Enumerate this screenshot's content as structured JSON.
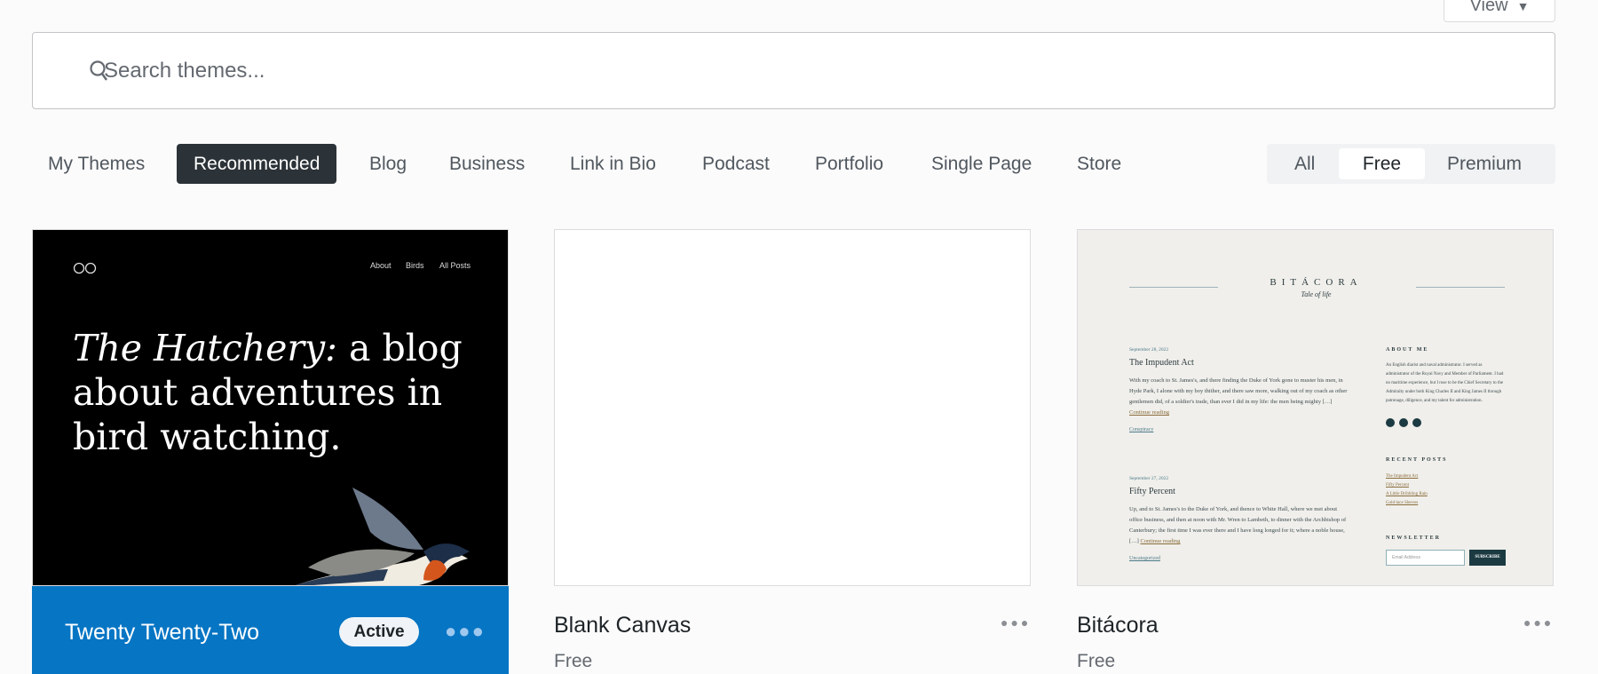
{
  "header": {
    "view_label": "View"
  },
  "search": {
    "placeholder": "Search themes..."
  },
  "tabs": [
    {
      "label": "My Themes"
    },
    {
      "label": "Recommended",
      "active": true
    },
    {
      "label": "Blog"
    },
    {
      "label": "Business"
    },
    {
      "label": "Link in Bio"
    },
    {
      "label": "Podcast"
    },
    {
      "label": "Portfolio"
    },
    {
      "label": "Single Page"
    },
    {
      "label": "Store"
    }
  ],
  "pricing": [
    {
      "label": "All"
    },
    {
      "label": "Free",
      "active": true
    },
    {
      "label": "Premium"
    }
  ],
  "colors": {
    "accent": "#0675c4",
    "active_tab": "#2c3338"
  },
  "themes": [
    {
      "name": "Twenty Twenty-Two",
      "badge": "Active",
      "preview": {
        "nav": [
          "About",
          "Birds",
          "All Posts"
        ],
        "headline_italic": "The Hatchery:",
        "headline_rest": " a blog about adventures in bird watching."
      }
    },
    {
      "name": "Blank Canvas",
      "price": "Free"
    },
    {
      "name": "Bitácora",
      "price": "Free",
      "preview": {
        "site_title": "BITÁCORA",
        "tagline": "Tale of life",
        "posts": [
          {
            "date": "September 28, 2022",
            "title": "The Impudent Act",
            "excerpt": "With my coach to St. James's, and there finding the Duke of York gone to muster his men, in Hyde Park, I alone with my boy thither, and there saw more, walking out of my coach as other gentlemen did, of a soldier's trade, than ever I did in my life: the men being mighty […]",
            "more": "Continue reading",
            "category": "Conspiracy"
          },
          {
            "date": "September 27, 2022",
            "title": "Fifty Percent",
            "excerpt": "Up, and to St. James's to the Duke of York, and thence to White Hall, where we met about office business, and then at noon with Mr. Wren to Lambeth, to dinner with the Archbishop of Canterbury; the first time I was ever there and I have long longed for it; where a noble house, […]",
            "more": "Continue reading",
            "category": "Uncategorized"
          }
        ],
        "about_heading": "ABOUT ME",
        "about_text": "An English diarist and naval administrator. I served as administrator of the Royal Navy and Member of Parliament. I had no maritime experience, but I rose to be the Chief Secretary to the Admiralty under both King Charles II and King James II through patronage, diligence, and my talent for administration.",
        "recent_heading": "RECENT POSTS",
        "recent": [
          "The Impudent Act",
          "Fifty Percent",
          "A Little Dribbling Rain",
          "Gold-lace Sleeves"
        ],
        "newsletter_heading": "NEWSLETTER",
        "email_placeholder": "Email Address",
        "subscribe": "SUBSCRIBE"
      }
    }
  ]
}
